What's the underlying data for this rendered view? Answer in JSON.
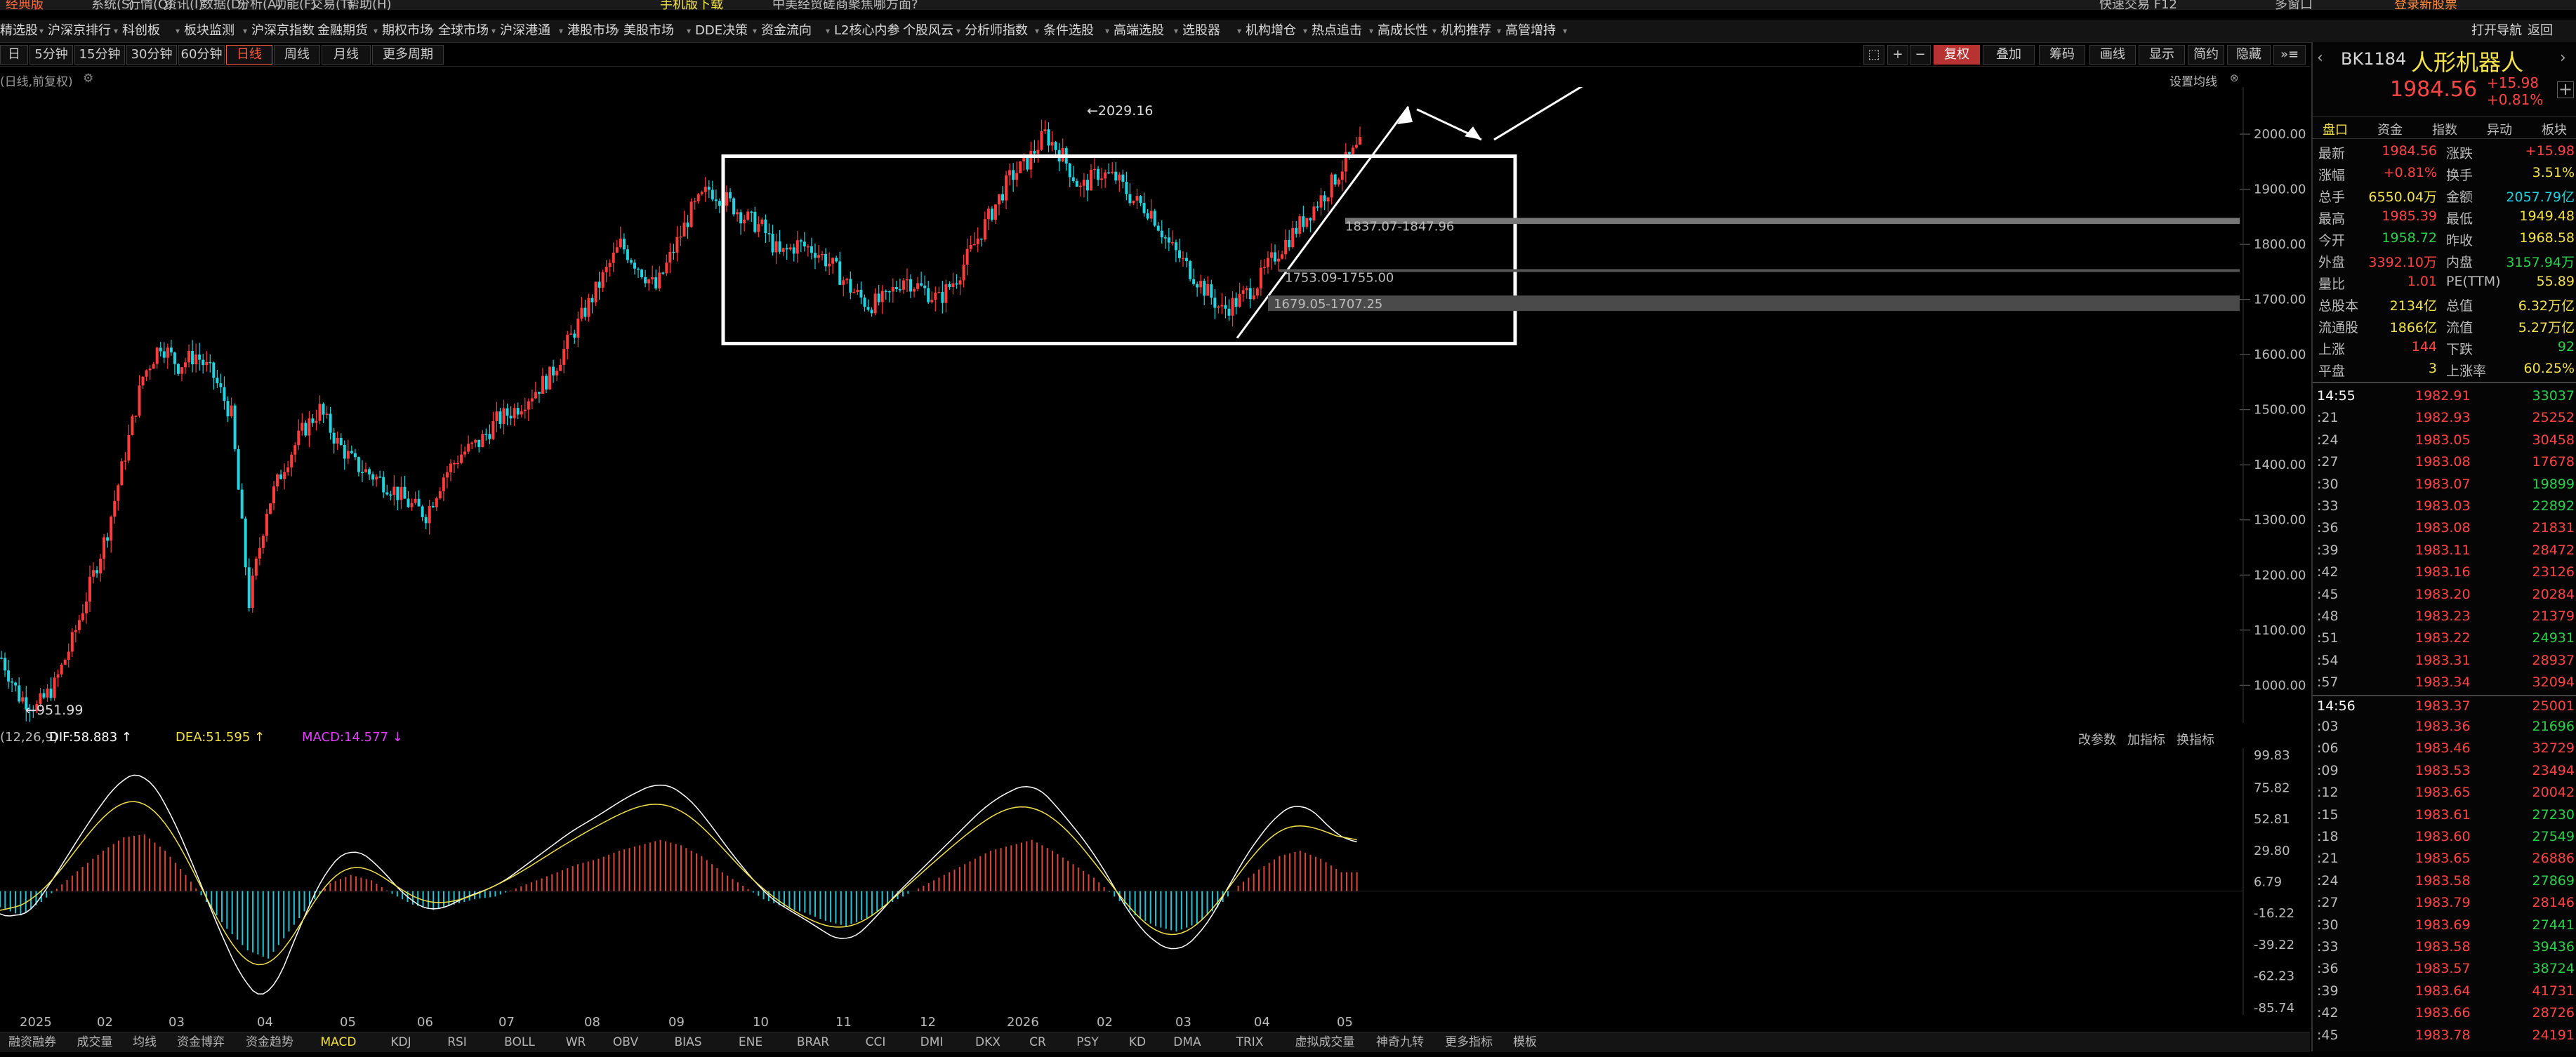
{
  "top_menu": {
    "app_name": "经典版",
    "items": [
      "系统(S)",
      "行情(Q)",
      "资讯(I)",
      "数据(D)",
      "分析(A)",
      "功能(F)",
      "交易(T)",
      "帮助(H)"
    ],
    "download": "手机版下载",
    "promo": "中美经贸磋商聚焦哪方面?",
    "shortcut": "快速交易 F12",
    "multi_screen": "多窗口",
    "login": "登录新股票"
  },
  "nav": {
    "items": [
      "精选股",
      "沪深京排行",
      "科创板",
      "板块监测",
      "沪深京指数",
      "金融期货",
      "期权市场",
      "全球市场",
      "沪深港通",
      "港股市场",
      "美股市场",
      "DDE决策",
      "资金流向",
      "L2核心内参",
      "个股风云",
      "分析师指数",
      "条件选股",
      "高端选股",
      "选股器",
      "机构增仓",
      "热点追击",
      "高成长性",
      "机构推荐",
      "高管增持"
    ],
    "open_nav": "打开导航",
    "back": "返回"
  },
  "toolbar": {
    "periods": [
      "日",
      "5分钟",
      "15分钟",
      "30分钟",
      "60分钟",
      "日线",
      "周线",
      "月线",
      "更多周期"
    ],
    "active_period": "日线",
    "right_buttons": [
      "复权",
      "叠加",
      "筹码",
      "画线",
      "显示",
      "简约",
      "隐藏"
    ],
    "zoom_in": "+",
    "zoom_out": "−"
  },
  "chart_header": {
    "adjust_label": "(日线,前复权)",
    "ma_settings": "设置均线"
  },
  "chart_data": {
    "type": "candlestick",
    "ylim": [
      951.99,
      2060
    ],
    "y_ticks": [
      "2000.00",
      "1900.00",
      "1800.00",
      "1700.00",
      "1600.00",
      "1500.00",
      "1400.00",
      "1300.00",
      "1200.00",
      "1100.00",
      "1000.00"
    ],
    "x_ticks": [
      "2025",
      "02",
      "03",
      "04",
      "05",
      "06",
      "07",
      "08",
      "09",
      "10",
      "11",
      "12",
      "2026",
      "02",
      "03",
      "04",
      "05"
    ],
    "high_label": "2029.16",
    "low_label": "951.99",
    "closes": [
      1050,
      980,
      960,
      1000,
      1080,
      1180,
      1280,
      1420,
      1560,
      1620,
      1580,
      1600,
      1560,
      1490,
      1150,
      1320,
      1400,
      1460,
      1500,
      1440,
      1400,
      1380,
      1360,
      1330,
      1310,
      1380,
      1420,
      1440,
      1480,
      1500,
      1530,
      1560,
      1620,
      1680,
      1740,
      1800,
      1760,
      1720,
      1790,
      1860,
      1900,
      1880,
      1850,
      1830,
      1780,
      1800,
      1790,
      1760,
      1720,
      1690,
      1700,
      1740,
      1720,
      1700,
      1740,
      1800,
      1860,
      1920,
      1950,
      2000,
      1960,
      1900,
      1930,
      1920,
      1880,
      1860,
      1800,
      1760,
      1720,
      1680,
      1700,
      1730,
      1780,
      1820,
      1860,
      1900,
      1950,
      1985
    ]
  },
  "annotations": {
    "range1": "1837.07-1847.96",
    "range2": "1753.09-1755.00",
    "range3": "1679.05-1707.25"
  },
  "macd": {
    "params": "(12,26,9)",
    "dif_label": "DIF:58.883 ↑",
    "dea_label": "DEA:51.595 ↑",
    "macd_label": "MACD:14.577 ↓",
    "y_ticks": [
      "99.83",
      "75.82",
      "52.81",
      "29.80",
      "6.79",
      "-16.22",
      "-39.22",
      "-62.23",
      "-85.74"
    ],
    "buttons": [
      "改参数",
      "加指标",
      "换指标"
    ],
    "hist": [
      -12,
      -18,
      -8,
      5,
      18,
      30,
      40,
      42,
      30,
      12,
      -8,
      -28,
      -44,
      -50,
      -30,
      -10,
      6,
      12,
      8,
      -2,
      -10,
      -14,
      -10,
      -6,
      -4,
      2,
      8,
      14,
      20,
      24,
      30,
      34,
      38,
      34,
      26,
      14,
      4,
      -6,
      -12,
      -16,
      -22,
      -26,
      -20,
      -10,
      -2,
      6,
      14,
      22,
      30,
      34,
      38,
      30,
      20,
      10,
      -4,
      -18,
      -26,
      -30,
      -24,
      -12,
      4,
      16,
      26,
      30,
      24,
      14
    ]
  },
  "indicator_tabs": [
    "融资融券",
    "成交量",
    "均线",
    "资金博弈",
    "资金趋势",
    "MACD",
    "KDJ",
    "RSI",
    "BOLL",
    "WR",
    "OBV",
    "BIAS",
    "ENE",
    "BRAR",
    "CCI",
    "DMI",
    "DKX",
    "CR",
    "PSY",
    "KD",
    "DMA",
    "TRIX",
    "虚拟成交量",
    "神奇九转",
    "更多指标",
    "模板"
  ],
  "active_indicator": "MACD",
  "stock": {
    "code": "BK1184",
    "name": "人形机器人",
    "price": "1984.56",
    "change": "+15.98",
    "change_pct": "+0.81%"
  },
  "panel_tabs": [
    "盘口",
    "资金",
    "指数",
    "异动",
    "板块"
  ],
  "quote_rows": [
    {
      "l1": "最新",
      "v1": "1984.56",
      "c1": "red",
      "l2": "涨跌",
      "v2": "+15.98",
      "c2": "red"
    },
    {
      "l1": "涨幅",
      "v1": "+0.81%",
      "c1": "red",
      "l2": "换手",
      "v2": "3.51%",
      "c2": "yel"
    },
    {
      "l1": "总手",
      "v1": "6550.04万",
      "c1": "yel",
      "l2": "金额",
      "v2": "2057.79亿",
      "c2": "cyan"
    },
    {
      "l1": "最高",
      "v1": "1985.39",
      "c1": "red",
      "l2": "最低",
      "v2": "1949.48",
      "c2": "yel"
    },
    {
      "l1": "今开",
      "v1": "1958.72",
      "c1": "green",
      "l2": "昨收",
      "v2": "1968.58",
      "c2": "yel"
    },
    {
      "l1": "外盘",
      "v1": "3392.10万",
      "c1": "red",
      "l2": "内盘",
      "v2": "3157.94万",
      "c2": "green"
    },
    {
      "l1": "量比",
      "v1": "1.01",
      "c1": "red",
      "l2": "PE(TTM)",
      "v2": "55.89",
      "c2": "yel"
    },
    {
      "l1": "总股本",
      "v1": "2134亿",
      "c1": "yel",
      "l2": "总值",
      "v2": "6.32万亿",
      "c2": "yel"
    },
    {
      "l1": "流通股",
      "v1": "1866亿",
      "c1": "yel",
      "l2": "流值",
      "v2": "5.27万亿",
      "c2": "yel"
    },
    {
      "l1": "上涨",
      "v1": "144",
      "c1": "red",
      "l2": "下跌",
      "v2": "92",
      "c2": "green"
    },
    {
      "l1": "平盘",
      "v1": "3",
      "c1": "yel",
      "l2": "上涨率",
      "v2": "60.25%",
      "c2": "yel"
    }
  ],
  "ticks": [
    {
      "t": "14:55",
      "p": "1982.91",
      "v": "33037",
      "vc": "green",
      "bold": true
    },
    {
      "t": ":21",
      "p": "1982.93",
      "v": "25252",
      "vc": "red"
    },
    {
      "t": ":24",
      "p": "1983.05",
      "v": "30458",
      "vc": "red"
    },
    {
      "t": ":27",
      "p": "1983.08",
      "v": "17678",
      "vc": "red"
    },
    {
      "t": ":30",
      "p": "1983.07",
      "v": "19899",
      "vc": "green"
    },
    {
      "t": ":33",
      "p": "1983.03",
      "v": "22892",
      "vc": "green"
    },
    {
      "t": ":36",
      "p": "1983.08",
      "v": "21831",
      "vc": "red"
    },
    {
      "t": ":39",
      "p": "1983.11",
      "v": "28472",
      "vc": "red"
    },
    {
      "t": ":42",
      "p": "1983.16",
      "v": "23126",
      "vc": "red"
    },
    {
      "t": ":45",
      "p": "1983.20",
      "v": "20284",
      "vc": "red"
    },
    {
      "t": ":48",
      "p": "1983.23",
      "v": "21379",
      "vc": "red"
    },
    {
      "t": ":51",
      "p": "1983.22",
      "v": "24931",
      "vc": "green"
    },
    {
      "t": ":54",
      "p": "1983.31",
      "v": "28937",
      "vc": "red"
    },
    {
      "t": ":57",
      "p": "1983.34",
      "v": "32094",
      "vc": "red"
    },
    {
      "t": "14:56",
      "p": "1983.37",
      "v": "25001",
      "vc": "red",
      "bold": true
    },
    {
      "t": ":03",
      "p": "1983.36",
      "v": "21696",
      "vc": "green"
    },
    {
      "t": ":06",
      "p": "1983.46",
      "v": "32729",
      "vc": "red"
    },
    {
      "t": ":09",
      "p": "1983.53",
      "v": "23494",
      "vc": "red"
    },
    {
      "t": ":12",
      "p": "1983.65",
      "v": "20042",
      "vc": "red"
    },
    {
      "t": ":15",
      "p": "1983.61",
      "v": "27230",
      "vc": "green"
    },
    {
      "t": ":18",
      "p": "1983.60",
      "v": "27549",
      "vc": "green"
    },
    {
      "t": ":21",
      "p": "1983.65",
      "v": "26886",
      "vc": "red"
    },
    {
      "t": ":24",
      "p": "1983.58",
      "v": "27869",
      "vc": "green"
    },
    {
      "t": ":27",
      "p": "1983.79",
      "v": "28146",
      "vc": "red"
    },
    {
      "t": ":30",
      "p": "1983.69",
      "v": "27441",
      "vc": "green"
    },
    {
      "t": ":33",
      "p": "1983.58",
      "v": "39436",
      "vc": "green"
    },
    {
      "t": ":36",
      "p": "1983.57",
      "v": "38724",
      "vc": "green"
    },
    {
      "t": ":39",
      "p": "1983.64",
      "v": "41731",
      "vc": "red"
    },
    {
      "t": ":42",
      "p": "1983.66",
      "v": "28726",
      "vc": "red"
    },
    {
      "t": ":45",
      "p": "1983.78",
      "v": "24191",
      "vc": "red"
    }
  ],
  "colors": {
    "up": "#ff3b3b",
    "down": "#22d3e0",
    "dif": "#ffffff",
    "dea": "#f2e14a",
    "accent": "#ff5a3c"
  }
}
